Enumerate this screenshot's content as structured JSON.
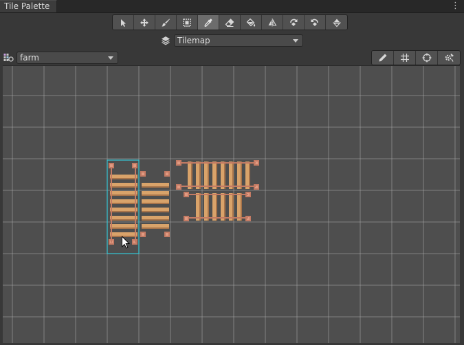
{
  "window": {
    "tab_title": "Tile Palette",
    "menu_icon": "kebab-menu-icon"
  },
  "toolbar": {
    "tools": [
      {
        "name": "select-tool",
        "icon": "arrow-pointer-icon",
        "active": false
      },
      {
        "name": "move-tool",
        "icon": "move-arrows-icon",
        "active": false
      },
      {
        "name": "brush-tool",
        "icon": "paintbrush-icon",
        "active": false
      },
      {
        "name": "box-fill-tool",
        "icon": "box-fill-icon",
        "active": false
      },
      {
        "name": "picker-tool",
        "icon": "eyedropper-icon",
        "active": true
      },
      {
        "name": "eraser-tool",
        "icon": "eraser-icon",
        "active": false
      },
      {
        "name": "fill-tool",
        "icon": "paint-bucket-icon",
        "active": false
      },
      {
        "name": "flip-tool",
        "icon": "flip-horizontal-icon",
        "active": false
      },
      {
        "name": "rotate-cw-tool",
        "icon": "rotate-clockwise-icon",
        "active": false
      },
      {
        "name": "rotate-ccw-tool",
        "icon": "rotate-counterclockwise-icon",
        "active": false
      },
      {
        "name": "flip-vertical-tool",
        "icon": "flip-vertical-icon",
        "active": false
      }
    ]
  },
  "tilemap": {
    "icon": "layers-icon",
    "selected": "Tilemap"
  },
  "palette": {
    "icon": "palette-grid-icon",
    "selected": "farm"
  },
  "view_tools": [
    {
      "name": "edit-palette-button",
      "icon": "pencil-icon"
    },
    {
      "name": "toggle-grid-button",
      "icon": "grid-icon"
    },
    {
      "name": "toggle-gizmos-button",
      "icon": "gizmo-icon"
    },
    {
      "name": "palette-settings-button",
      "icon": "gear-icon"
    }
  ],
  "colors": {
    "selection": "#35c8d8",
    "grid_line": "#a8a8a8",
    "canvas_bg": "#4e4e4e",
    "plank": "#d9a36a",
    "plank_dark": "#a8744a",
    "post": "#c47b64"
  }
}
